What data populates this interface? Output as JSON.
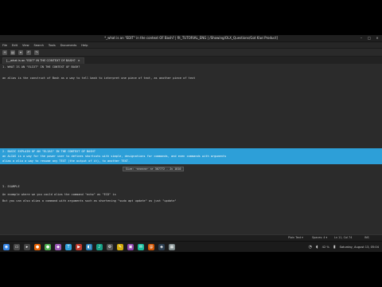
{
  "window": {
    "title": "*_what is an \"EDIT\" in the context OF Bash? | fit_TUTORIAL_ENG | /Showing/OLX_Questions/Got Kiwi Product]",
    "minimize": "–",
    "maximize": "□",
    "close": "×"
  },
  "menu": [
    "File",
    "Edit",
    "View",
    "Search",
    "Tools",
    "Documents",
    "Help"
  ],
  "toolbar": {
    "buttons": [
      {
        "icon": "new-file-icon",
        "glyph": "+"
      },
      {
        "icon": "open-file-icon",
        "glyph": "▤"
      },
      {
        "icon": "save-icon",
        "glyph": "▾"
      },
      {
        "icon": "undo-icon",
        "glyph": "↶"
      },
      {
        "icon": "redo-icon",
        "glyph": "↷"
      }
    ]
  },
  "tab": {
    "label": "[__what is an \"EDIT\" IN THE CONTEXT OF BASH?",
    "close": "×"
  },
  "editor": {
    "lines": [
      {
        "text": "1. WHAT IS AN \"ELIXT\" IN THE CONTEXT OF BASH?"
      },
      {
        "text": "an alias is the construct of Bash as a way to tell bash to interpret one piece of text, as another piece of text"
      },
      {
        "text": "2. BASIC EXPLAIN OF AN \"ELIAS\" IN THE CONTEXT OF BASH?"
      },
      {
        "text": "an ALIAS is a way for the power user to defines shortcuts with simple, designations for commands, and even commands with arguments"
      },
      {
        "text": "alias a alia a way to resume any TEXT (the output of it), to another TEXT."
      },
      {
        "text": "3. EXAMPLE"
      },
      {
        "text": "An example where we you could alias the command \"echo\" as \"ECO\" is"
      },
      {
        "text": "But you can also alias a command with arguments such as shortening \"sudo apt update\" as just \"update\""
      }
    ],
    "tooltip": "Size: ~nnnnnn~ nr 307772 - Jv 1810"
  },
  "status": {
    "left": "",
    "mode": "Plain Text ▾",
    "tabs": "Spaces: 4 ▾",
    "position": "Ln 11, Col 74",
    "insert": "INS"
  },
  "taskbar": {
    "apps": [
      {
        "icon": "menu-icon",
        "glyph": "◉",
        "color": "#3584e4"
      },
      {
        "icon": "files-icon",
        "glyph": "▭",
        "color": "#4a4a4a"
      },
      {
        "icon": "terminal-icon",
        "glyph": "▸",
        "color": "#444"
      },
      {
        "icon": "firefox-icon",
        "glyph": "●",
        "color": "#e66000"
      },
      {
        "icon": "chrome-icon",
        "glyph": "●",
        "color": "#4caf50"
      },
      {
        "icon": "image-icon",
        "glyph": "◆",
        "color": "#9b59b6"
      },
      {
        "icon": "text-icon",
        "glyph": "T",
        "color": "#2d9fd8"
      },
      {
        "icon": "video-icon",
        "glyph": "▶",
        "color": "#c0392b"
      },
      {
        "icon": "code-icon",
        "glyph": "◧",
        "color": "#2980b9"
      },
      {
        "icon": "music-icon",
        "glyph": "♪",
        "color": "#16a085"
      },
      {
        "icon": "settings-icon",
        "glyph": "⚙",
        "color": "#555"
      },
      {
        "icon": "notes-icon",
        "glyph": "✎",
        "color": "#d4ac0d"
      },
      {
        "icon": "store-icon",
        "glyph": "▣",
        "color": "#8e44ad"
      },
      {
        "icon": "chat-icon",
        "glyph": "✉",
        "color": "#1abc9c"
      },
      {
        "icon": "mail-icon",
        "glyph": "@",
        "color": "#d35400"
      },
      {
        "icon": "shield-icon",
        "glyph": "◈",
        "color": "#2c3e50"
      },
      {
        "icon": "calendar-icon",
        "glyph": "▦",
        "color": "#7f8c8d"
      }
    ],
    "volume": "42 %",
    "clock": "Saturday, August 13, 05:04"
  }
}
